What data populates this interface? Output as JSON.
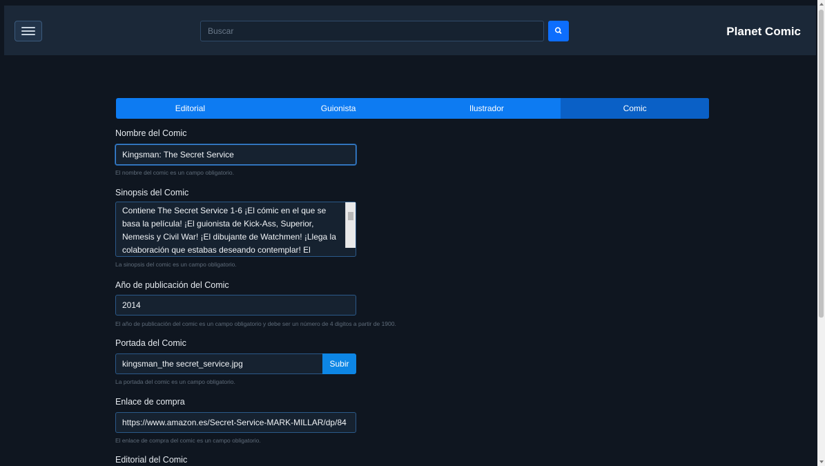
{
  "navbar": {
    "search_placeholder": "Buscar",
    "brand": "Planet Comic",
    "icons": {
      "menu": "hamburger-icon",
      "search": "magnifier-icon"
    }
  },
  "tabs": [
    {
      "label": "Editorial",
      "active": false
    },
    {
      "label": "Guionista",
      "active": false
    },
    {
      "label": "Ilustrador",
      "active": false
    },
    {
      "label": "Comic",
      "active": true
    }
  ],
  "form": {
    "name": {
      "label": "Nombre del Comic",
      "value": "Kingsman: The Secret Service",
      "help": "El nombre del comic es un campo obligatorio."
    },
    "synopsis": {
      "label": "Sinopsis del Comic",
      "value": "Contiene The Secret Service 1-6 ¡El cómic en el que se basa la película! ¡El guionista de Kick-Ass, Superior, Nemesis y Civil War! ¡El dibujante de Watchmen! ¡Llega la colaboración que estabas deseando contemplar! El",
      "help": "La sinopsis del comic es un campo obligatorio."
    },
    "year": {
      "label": "Año de publicación del Comic",
      "value": "2014",
      "help": "El año de publicación del comic es un campo obligatorio y debe ser un número de 4 digitos a partir de 1900."
    },
    "cover": {
      "label": "Portada del Comic",
      "value": "kingsman_the secret_service.jpg",
      "button": "Subir",
      "help": "La portada del comic es un campo obligatorio."
    },
    "purchase_link": {
      "label": "Enlace de compra",
      "value": "https://www.amazon.es/Secret-Service-MARK-MILLAR/dp/84",
      "help": "El enlace de compra del comic es un campo obligatorio."
    },
    "publisher": {
      "label": "Editorial del Comic"
    }
  },
  "colors": {
    "background": "#0f1620",
    "navbar": "#1b2838",
    "accent": "#0d6efd",
    "tab_bar": "#0d7bf2",
    "tab_active": "#0a60c6"
  }
}
